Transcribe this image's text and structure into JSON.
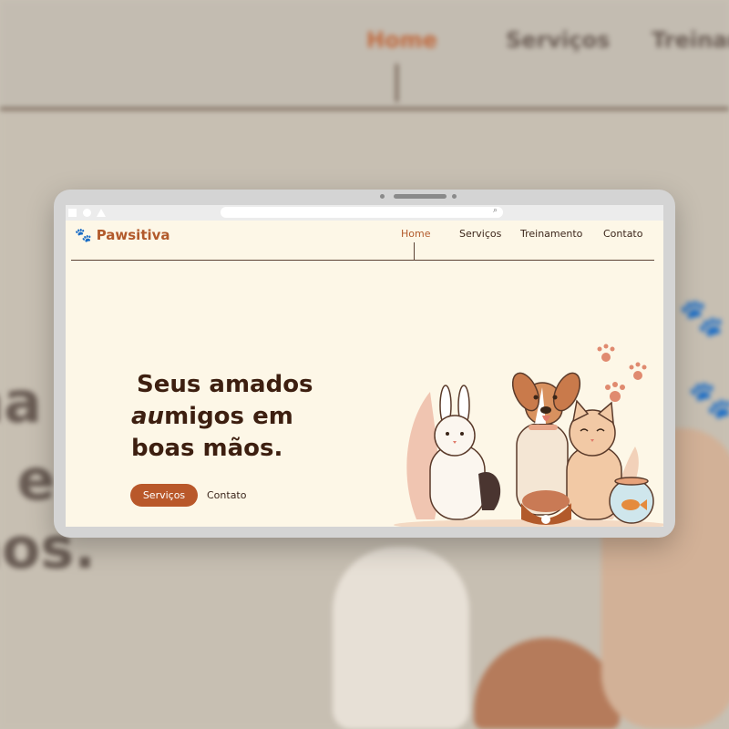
{
  "brand": {
    "name": "Pawsitiva",
    "icon": "paw-icon"
  },
  "nav": {
    "items": [
      "Home",
      "Serviços",
      "Treinamento",
      "Contato"
    ],
    "active": "Home"
  },
  "background": {
    "nav": [
      "Home",
      "Serviços",
      "Treinam"
    ]
  },
  "hero": {
    "line1": "Seus amados",
    "au": "au",
    "line2_rest": "migos em",
    "line3": "boas mãos."
  },
  "buttons": {
    "primary": "Serviços",
    "secondary": "Contato"
  },
  "colors": {
    "accent": "#b9582a",
    "bg": "#fdf7e7",
    "dark": "#3d1f10"
  }
}
